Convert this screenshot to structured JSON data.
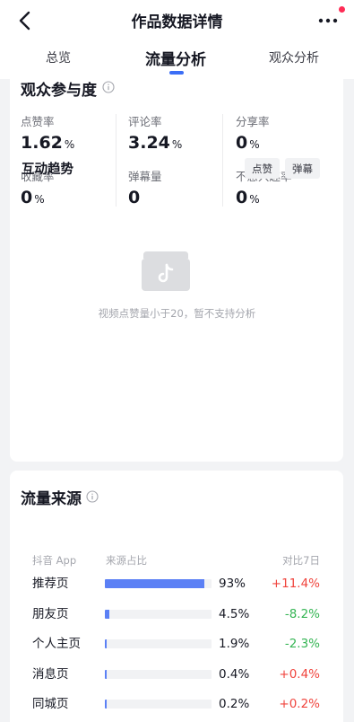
{
  "header": {
    "title": "作品数据详情"
  },
  "tabs": [
    {
      "label": "总览",
      "active": false
    },
    {
      "label": "流量分析",
      "active": true
    },
    {
      "label": "观众分析",
      "active": false
    }
  ],
  "engagement": {
    "title": "观众参与度",
    "metrics": [
      {
        "label": "点赞率",
        "value": "1.62",
        "unit": "%"
      },
      {
        "label": "评论率",
        "value": "3.24",
        "unit": "%"
      },
      {
        "label": "分享率",
        "value": "0",
        "unit": "%"
      },
      {
        "label": "收藏率",
        "value": "0",
        "unit": "%"
      },
      {
        "label": "弹幕量",
        "value": "0",
        "unit": ""
      },
      {
        "label": "不感兴趣率",
        "value": "0",
        "unit": "%"
      }
    ],
    "trend_title": "互动趋势",
    "chips": [
      "点赞",
      "弹幕"
    ],
    "empty_message": "视频点赞量小于20，暂不支持分析"
  },
  "traffic": {
    "title": "流量来源",
    "columns": [
      "抖音 App",
      "来源占比",
      "对比7日"
    ],
    "rows": [
      {
        "name": "推荐页",
        "percent_label": "93%",
        "percent": 93,
        "compare": "+11.4%",
        "trend": "up"
      },
      {
        "name": "朋友页",
        "percent_label": "4.5%",
        "percent": 4.5,
        "compare": "-8.2%",
        "trend": "down"
      },
      {
        "name": "个人主页",
        "percent_label": "1.9%",
        "percent": 1.9,
        "compare": "-2.3%",
        "trend": "down"
      },
      {
        "name": "消息页",
        "percent_label": "0.4%",
        "percent": 0.4,
        "compare": "+0.4%",
        "trend": "up"
      },
      {
        "name": "同城页",
        "percent_label": "0.2%",
        "percent": 0.2,
        "compare": "+0.2%",
        "trend": "up"
      }
    ]
  },
  "colors": {
    "accent": "#3b6ef6",
    "bar": "#5b80f5",
    "up": "#f0443d",
    "down": "#35b554",
    "notification": "#fe2c55"
  },
  "icons": {
    "back": "chevron-left-icon",
    "more": "more-dots-icon",
    "info": "info-icon",
    "empty": "tiktok-box-icon"
  }
}
